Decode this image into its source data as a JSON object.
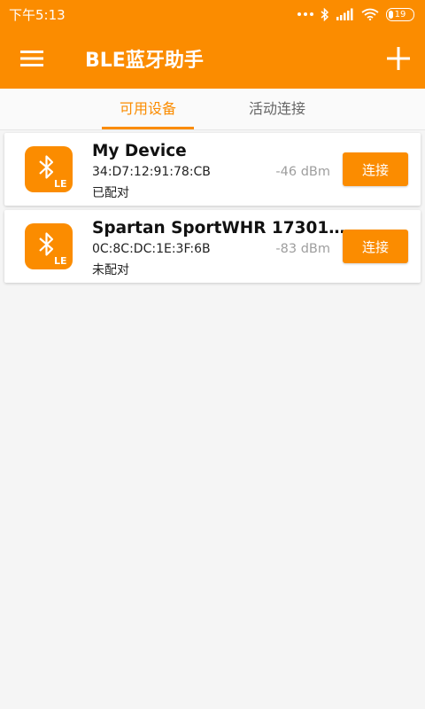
{
  "status_bar": {
    "time": "下午5:13",
    "battery": "19",
    "battery_level": 0.19
  },
  "app_bar": {
    "title": "BLE蓝牙助手",
    "menu_icon": "menu-icon",
    "add_icon": "add-icon"
  },
  "tabs": [
    {
      "label": "可用设备",
      "active": true
    },
    {
      "label": "活动连接",
      "active": false
    }
  ],
  "devices": [
    {
      "name": "My Device",
      "mac": "34:D7:12:91:78:CB",
      "bond": "已配对",
      "rssi": "-46 dBm",
      "action": "连接",
      "icon": "bluetooth-le-icon"
    },
    {
      "name": "Spartan SportWHR 17301…",
      "mac": "0C:8C:DC:1E:3F:6B",
      "bond": "未配对",
      "rssi": "-83 dBm",
      "action": "连接",
      "icon": "bluetooth-le-icon"
    }
  ],
  "colors": {
    "accent": "#fb8c00",
    "background": "#f5f5f5"
  }
}
